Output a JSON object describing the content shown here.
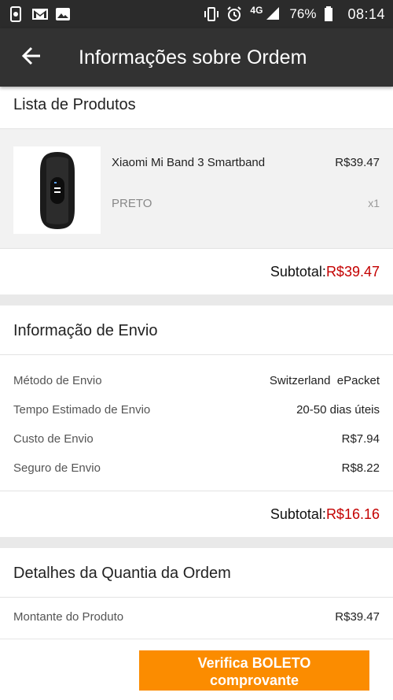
{
  "status_bar": {
    "icons_left": [
      "screen-lock-icon",
      "gmail-icon",
      "gallery-icon"
    ],
    "network": "4G",
    "battery": "76%",
    "time": "08:14"
  },
  "app_bar": {
    "title": "Informações sobre Ordem"
  },
  "products_section": {
    "title": "Lista de Produtos",
    "items": [
      {
        "name": "Xiaomi Mi Band 3 Smartband",
        "price": "R$39.47",
        "variant": "PRETO",
        "quantity": "x1"
      }
    ],
    "subtotal_label": "Subtotal:",
    "subtotal_value": "R$39.47"
  },
  "shipping_section": {
    "title": "Informação de Envio",
    "rows": [
      {
        "label": "Método de Envio",
        "value": "Switzerland  ePacket"
      },
      {
        "label": "Tempo Estimado de Envio",
        "value": "20-50 dias úteis"
      },
      {
        "label": "Custo de Envio",
        "value": "R$7.94"
      },
      {
        "label": "Seguro de Envio",
        "value": "R$8.22"
      }
    ],
    "subtotal_label": "Subtotal:",
    "subtotal_value": "R$16.16"
  },
  "amount_section": {
    "title": "Detalhes da Quantia da Ordem",
    "rows": [
      {
        "label": "Montante do Produto",
        "value": "R$39.47"
      }
    ]
  },
  "action": {
    "label_line1": "Verifica BOLETO",
    "label_line2": "comprovante"
  },
  "colors": {
    "accent": "#fb8c00",
    "price_red": "#c40000",
    "appbar": "#323232"
  }
}
